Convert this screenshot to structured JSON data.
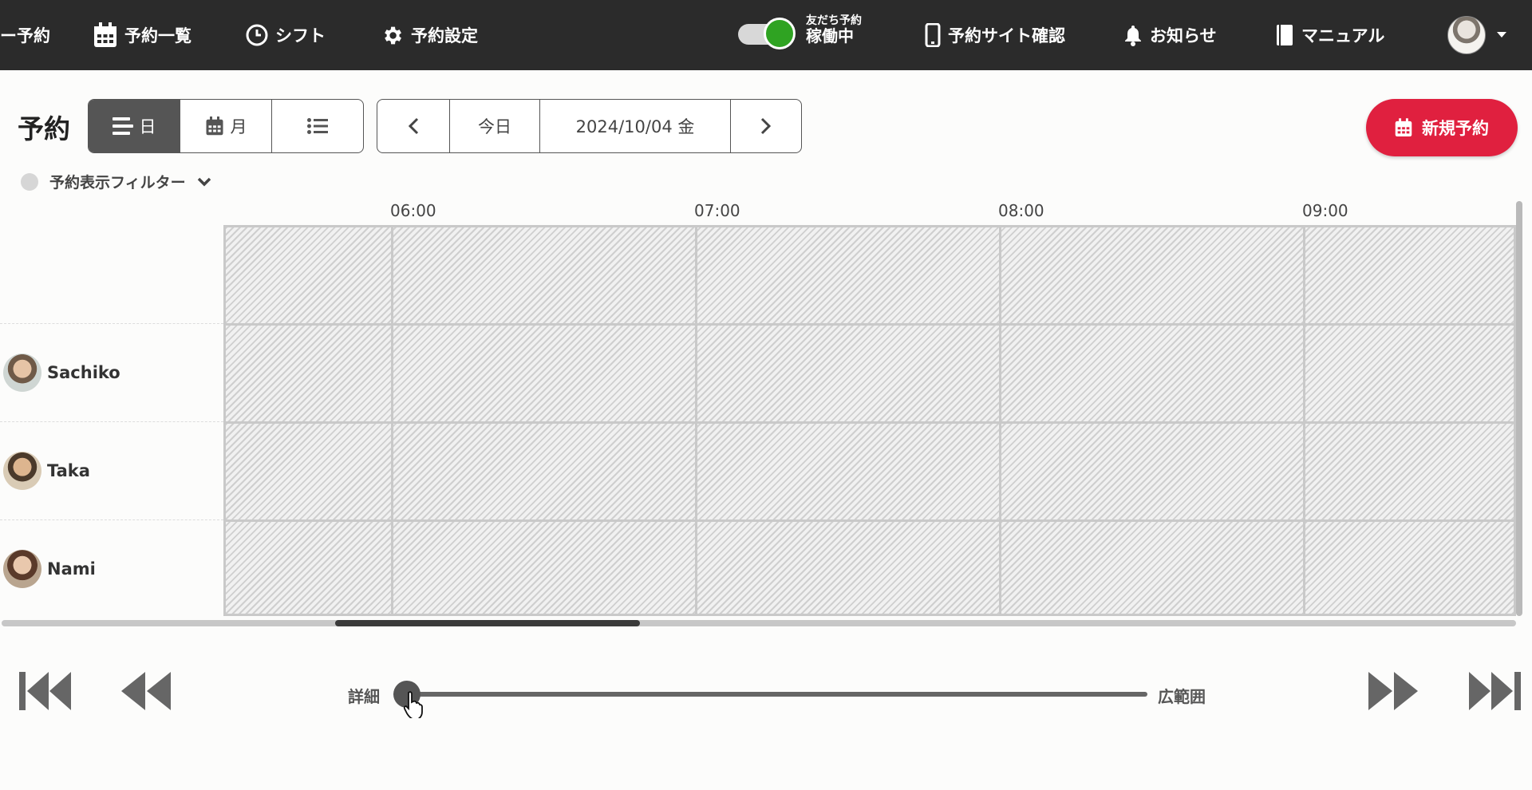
{
  "nav": {
    "items": [
      {
        "label": "ー予約",
        "icon": "none"
      },
      {
        "label": "予約一覧",
        "icon": "calendar-icon"
      },
      {
        "label": "シフト",
        "icon": "clock-icon"
      },
      {
        "label": "予約設定",
        "icon": "gear-icon"
      }
    ],
    "toggle": {
      "title": "友だち予約",
      "status": "稼働中",
      "on": true,
      "on_color": "#2fa322"
    },
    "right_items": [
      {
        "label": "予約サイト確認",
        "icon": "phone-icon"
      },
      {
        "label": "お知らせ",
        "icon": "bell-icon"
      },
      {
        "label": "マニュアル",
        "icon": "book-icon"
      }
    ]
  },
  "toolbar": {
    "title": "予約",
    "views": [
      {
        "label": "日",
        "icon": "day-list-icon",
        "active": true
      },
      {
        "label": "月",
        "icon": "calendar-icon",
        "active": false
      },
      {
        "label": "",
        "icon": "list-icon",
        "active": false
      }
    ],
    "today_label": "今日",
    "date_label": "2024/10/04 金",
    "new_button_label": "新規予約",
    "accent_color": "#e0203f"
  },
  "filter": {
    "label": "予約表示フィルター"
  },
  "schedule": {
    "times": [
      "06:00",
      "07:00",
      "08:00",
      "09:00"
    ],
    "staff": [
      {
        "name": "Sachiko"
      },
      {
        "name": "Taka"
      },
      {
        "name": "Nami"
      }
    ]
  },
  "controls": {
    "zoom_min_label": "詳細",
    "zoom_max_label": "広範囲",
    "zoom_level": 0
  }
}
